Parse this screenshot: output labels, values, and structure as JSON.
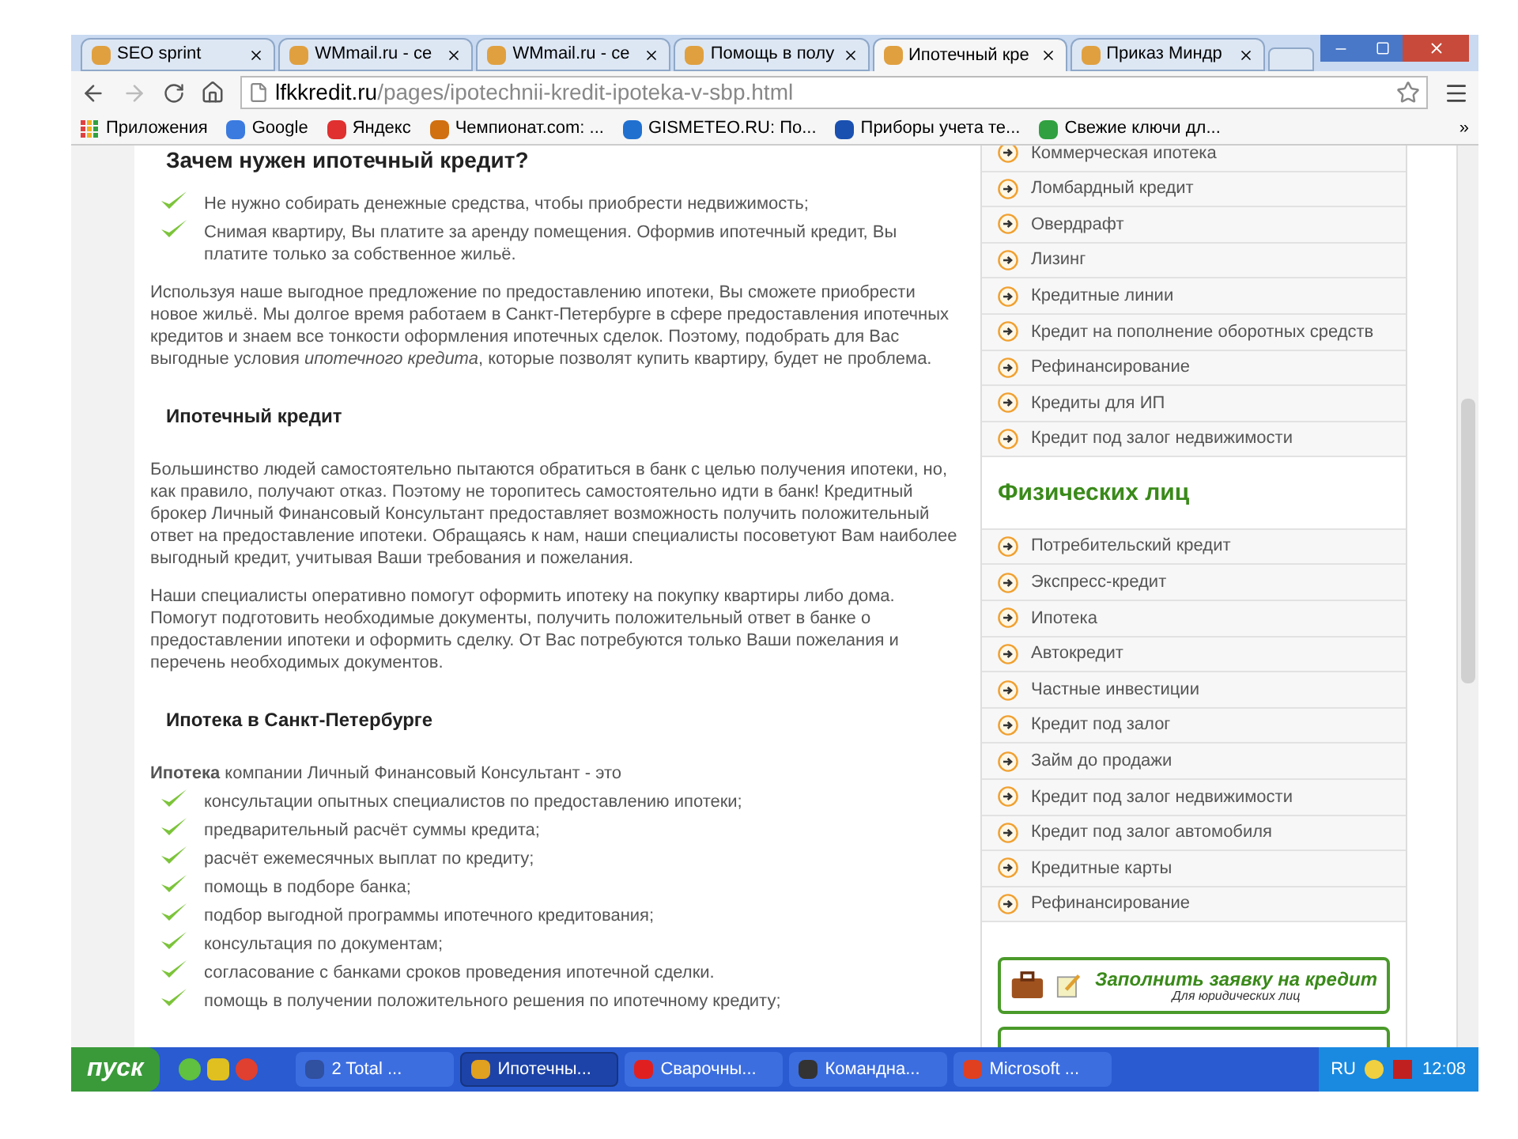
{
  "tabs": [
    {
      "title": "SEO sprint",
      "selected": false
    },
    {
      "title": "WMmail.ru - се",
      "selected": false
    },
    {
      "title": "WMmail.ru - се",
      "selected": false
    },
    {
      "title": "Помощь в полу",
      "selected": false
    },
    {
      "title": "Ипотечный кре",
      "selected": true
    },
    {
      "title": "Приказ Миндр",
      "selected": false
    }
  ],
  "address_bar": {
    "domain": "lfkkredit.ru",
    "path": "/pages/ipotechnii-kredit-ipoteka-v-sbp.html"
  },
  "bookmarks": [
    {
      "label": "Приложения",
      "kind": "apps"
    },
    {
      "label": "Google",
      "kind": "google"
    },
    {
      "label": "Яндекс",
      "kind": "yandex"
    },
    {
      "label": "Чемпионат.com: ...",
      "kind": "shield"
    },
    {
      "label": "GISMETEO.RU: По...",
      "kind": "drop"
    },
    {
      "label": "Приборы учета те...",
      "kind": "globe"
    },
    {
      "label": "Свежие ключи дл...",
      "kind": "key"
    }
  ],
  "bookmarks_overflow": "»",
  "article": [
    {
      "kind": "heading",
      "text": "Зачем нужен ипотечный кредит?"
    },
    {
      "kind": "checklist",
      "items": [
        "Не нужно собирать денежные средства, чтобы приобрести недвижимость;",
        "Снимая квартиру, Вы платите за аренду помещения. Оформив ипотечный кредит, Вы платите только за собственное жильё."
      ]
    },
    {
      "kind": "paragraph",
      "text": "Используя наше выгодное предложение по предоставлению ипотеки, Вы сможете приобрести новое жильё. Мы долгое время работаем в Санкт-Петербурге в сфере предоставления ипотечных кредитов и знаем все тонкости оформления ипотечных сделок. Поэтому, подобрать для Вас выгодные условия *ипотечного кредита*, которые позволят купить квартиру, будет не проблема."
    },
    {
      "kind": "heading",
      "text": "Ипотечный кредит"
    },
    {
      "kind": "paragraph",
      "text": "Большинство людей самостоятельно пытаются обратиться в банк с целью получения ипотеки, но, как правило, получают отказ. Поэтому не торопитесь самостоятельно идти в банк! Кредитный брокер Личный Финансовый Консультант предоставляет возможность получить положительный ответ на предоставление ипотеки. Обращаясь к нам, наши специалисты посоветуют Вам наиболее выгодный кредит, учитывая Ваши требования и пожелания."
    },
    {
      "kind": "paragraph",
      "text": "Наши специалисты оперативно помогут оформить ипотеку на покупку квартиры либо дома. Помогут подготовить необходимые документы, получить положительный ответ в банке о предоставлении ипотеки и оформить сделку. От Вас потребуются только Ваши пожелания и перечень необходимых документов."
    },
    {
      "kind": "heading",
      "text": "Ипотека в Санкт-Петербурге"
    },
    {
      "kind": "paragraph",
      "text": "**Ипотека** компании Личный Финансовый Консультант - это"
    },
    {
      "kind": "checklist",
      "items": [
        "консультации опытных специалистов по предоставлению ипотеки;",
        "предварительный расчёт суммы кредита;",
        "расчёт ежемесячных выплат по кредиту;",
        "помощь в подборе банка;",
        "подбор выгодной программы ипотечного кредитования;",
        "консультация по документам;",
        "согласование с банками сроков проведения ипотечной сделки.",
        "помощь в получении положительного решения по ипотечному кредиту;"
      ]
    }
  ],
  "sidebar": {
    "business_links": [
      "Коммерческая ипотека",
      "Ломбардный кредит",
      "Овердрафт",
      "Лизинг",
      "Кредитные линии",
      "Кредит на пополнение оборотных средств",
      "Рефинансирование",
      "Кредиты для ИП",
      "Кредит под залог недвижимости"
    ],
    "individuals_heading": "Физических лиц",
    "individual_links": [
      "Потребительский кредит",
      "Экспресс-кредит",
      "Ипотека",
      "Автокредит",
      "Частные инвестиции",
      "Кредит под залог",
      "Займ до продажи",
      "Кредит под залог недвижимости",
      "Кредит под залог автомобиля",
      "Кредитные карты",
      "Рефинансирование"
    ],
    "apply_button": {
      "title": "Заполнить заявку на кредит",
      "subtitle": "Для юридических лиц"
    }
  },
  "taskbar": {
    "start": "пуск",
    "tasks": [
      {
        "label": "2 Total ...",
        "kind": "disk",
        "selected": false
      },
      {
        "label": "Ипотечны...",
        "kind": "chrome",
        "selected": true
      },
      {
        "label": "Сварочны...",
        "kind": "yandex",
        "selected": false
      },
      {
        "label": "Командна...",
        "kind": "console",
        "selected": false
      },
      {
        "label": "Microsoft ...",
        "kind": "office",
        "selected": false
      }
    ],
    "language": "RU",
    "clock": "12:08"
  }
}
